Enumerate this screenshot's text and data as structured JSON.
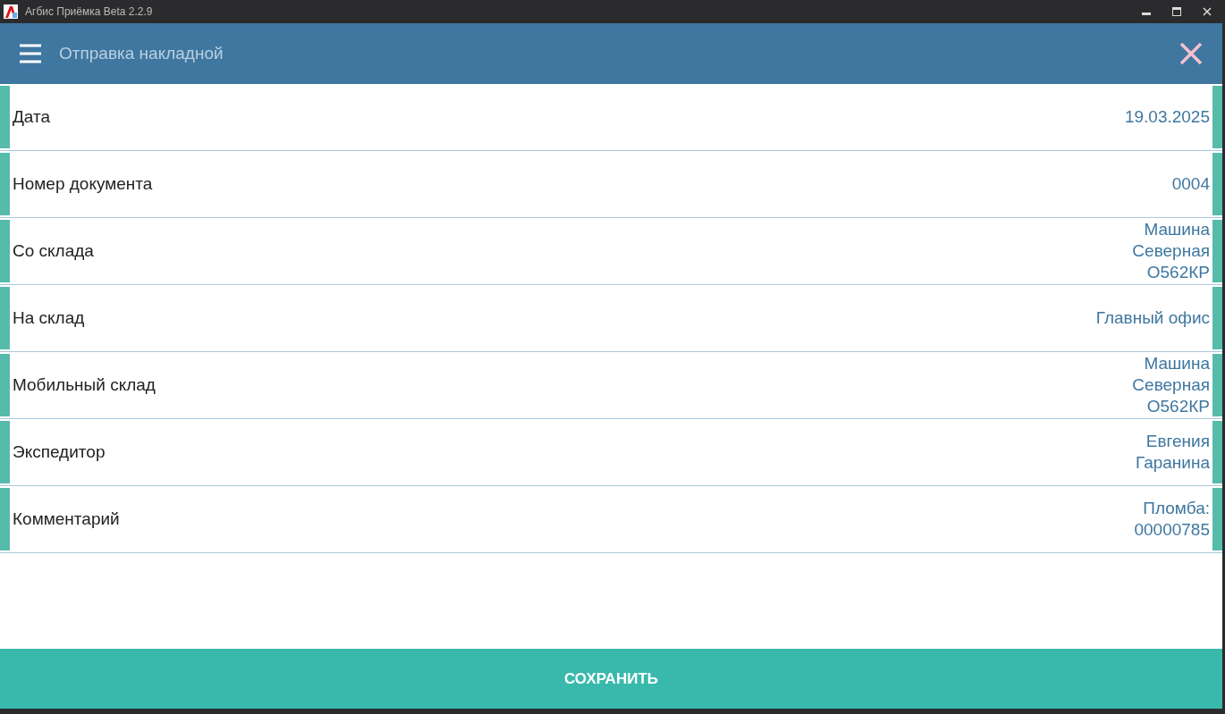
{
  "window": {
    "title": "Агбис Приёмка Beta 2.2.9"
  },
  "header": {
    "title": "Отправка накладной"
  },
  "fields": [
    {
      "label": "Дата",
      "value_lines": [
        "19.03.2025"
      ]
    },
    {
      "label": "Номер документа",
      "value_lines": [
        "0004"
      ]
    },
    {
      "label": "Со склада",
      "value_lines": [
        "Машина",
        "Северная",
        "О562КР"
      ]
    },
    {
      "label": "На склад",
      "value_lines": [
        "Главный офис"
      ]
    },
    {
      "label": "Мобильный склад",
      "value_lines": [
        "Машина",
        "Северная",
        "О562КР"
      ]
    },
    {
      "label": "Экспедитор",
      "value_lines": [
        "Евгения",
        "Гаранина"
      ]
    },
    {
      "label": "Комментарий",
      "value_lines": [
        "Пломба:",
        "00000785"
      ]
    }
  ],
  "save_button": {
    "label": "СОХРАНИТЬ"
  }
}
